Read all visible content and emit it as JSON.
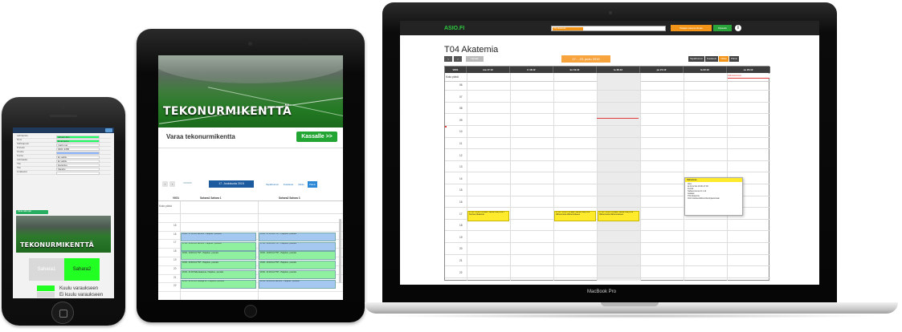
{
  "phone": {
    "topbar_title": "Asiakas / Jaiswal Laajat 21.12.2015 kauko 10:00",
    "form": [
      {
        "label": "Lähtöpiste",
        "value": "Juhani Alin"
      },
      {
        "label": "Nimi",
        "value": "Ei annettu"
      },
      {
        "label": "Sähköposti",
        "value": "matti.mei"
      },
      {
        "label": "Puhelin",
        "value": "0401 3456"
      },
      {
        "label": "Osoite",
        "value": ""
      },
      {
        "label": "Kunta",
        "value": "Ei valittu"
      },
      {
        "label": "Lähtöaika",
        "value": "Ei valittu"
      },
      {
        "label": "Tila",
        "value": "Harjoitus"
      },
      {
        "label": "Tila",
        "value": "Varattu"
      },
      {
        "label": "Lisätiedot",
        "value": ""
      }
    ],
    "action_button": "Varaa valitut ajat",
    "image_title": "TEKONURMIKENTTÄ",
    "tab1": "Sahara1",
    "tab2": "Sahara2",
    "legend_in": "Kuulu varaukseen",
    "legend_out": "Ei kuulu varaukseen",
    "legend_in_color": "#22ff22",
    "legend_out_color": "#d9d9d9"
  },
  "tablet": {
    "image_title": "TEKONURMIKENTTÄ",
    "page_title": "Varaa tekonurmikentta",
    "checkout_button": "Kassalle >>",
    "today_label": "Tänään",
    "date_range": "17. Joulukuuta 2015",
    "views": [
      "Tapahtumat",
      "Kuukausi",
      "Viikko",
      "Päivä"
    ],
    "active_view": "Päivä",
    "columns": [
      "VK51",
      "Sahara1 Sahara 1",
      "Sahara2 Sahara 3"
    ],
    "allday_label": "Koko päivä",
    "hours": [
      "15",
      "16",
      "17",
      "18",
      "19",
      "20",
      "21",
      "22"
    ],
    "events_col1": [
      {
        "time": "16:00 - 17:00",
        "text": "FoV BRJ/RV - Harjoitus - peruuttu",
        "color": "blue"
      },
      {
        "time": "17:00 - 18:00",
        "text": "FoV BRJ/RV - Harjoitus - peruuttu",
        "color": "green"
      },
      {
        "time": "18:00 - 19:00",
        "text": "FoV TNT - Harjoitus - peruuttu",
        "color": "green"
      },
      {
        "time": "19:00 - 20:00",
        "text": "FoV TNT - Harjoitus - peruuttu",
        "color": "green"
      },
      {
        "time": "20:00 - 21:00",
        "text": "Pallo-Akatemia - Harjoitus - peruuttu",
        "color": "green"
      },
      {
        "time": "21:00 - 22:00",
        "text": "FoV Leikkijät 01 - Harjoitus - peruuttu",
        "color": "green"
      }
    ],
    "events_col2": [
      {
        "time": "16:00 - 17:00",
        "text": "FoV TNT - Harjoitus - peruuttu",
        "color": "blue"
      },
      {
        "time": "17:00 - 18:00",
        "text": "FoV TNT - Harjoitus - peruuttu",
        "color": "blue"
      },
      {
        "time": "18:00 - 19:00",
        "text": "FoV TNT - Harjoitus - peruuttu",
        "color": "green"
      },
      {
        "time": "19:00 - 20:00",
        "text": "FoV TNT - Harjoitus - peruuttu",
        "color": "green"
      },
      {
        "time": "20:00 - 21:00",
        "text": "FoV TNT - Harjoitus - peruuttu",
        "color": "green"
      },
      {
        "time": "21:00 - 22:00",
        "text": "FoV BRJ/RV - Harjoitus - peruuttu",
        "color": "blue"
      }
    ]
  },
  "laptop": {
    "logo": "ASIO.FI",
    "search_tag": "T04 Akatemia",
    "button_calendar": "Tilaajan kalenterihaku",
    "button_logout": "Kirjaudu",
    "page_title": "T04 Akatemia",
    "today_label": "Tänään",
    "date_range": "17. - 23. joulu 2015",
    "views": [
      "Tapahtumat",
      "Kuukausi",
      "Viikko",
      "Päivä"
    ],
    "active_view": "Viikko",
    "week_label": "Vk51",
    "days": [
      "ma 17.12",
      "ti 18.12",
      "ke 19.12",
      "to 20.12",
      "pe 21.12",
      "la 22.12",
      "su 23.12"
    ],
    "allday_label": "Koko päivä",
    "hours": [
      "06",
      "07",
      "08",
      "09",
      "10",
      "11",
      "12",
      "13",
      "14",
      "15",
      "16",
      "17",
      "18",
      "19",
      "20",
      "21",
      "22"
    ],
    "red_note": "Vaihtoehtoinen",
    "events": [
      {
        "day": 0,
        "time": "17:00 - 18:00",
        "text": "T04 akat. Valmennusryhmä 1 Suomen Akatemia"
      },
      {
        "day": 2,
        "time": "17:00 - 18:00",
        "text": "T04 akat. Valmennusryhmä Valmennusta Valmennukseen"
      },
      {
        "day": 3,
        "time": "17:00 - 18:00",
        "text": "T04 akat. Valmennusryhmä Valmennusta Valmennukseen"
      },
      {
        "day": 5,
        "time": "16:00 - 16:30",
        "text": "T04 akat. Valmennusryhmä Suomen Akatemia"
      }
    ],
    "popup": {
      "header": "Valmennus",
      "lines": [
        "Aika:",
        "la 22.12 klo 16:00-17:00",
        "Kenttä:",
        "Sahara Arena 21.1.12",
        "Asiakas:",
        "T04 Akatemia",
        "Voit hoitokoa lähitunnilla kirjautumaan"
      ]
    },
    "brand": "MacBook Pro"
  }
}
